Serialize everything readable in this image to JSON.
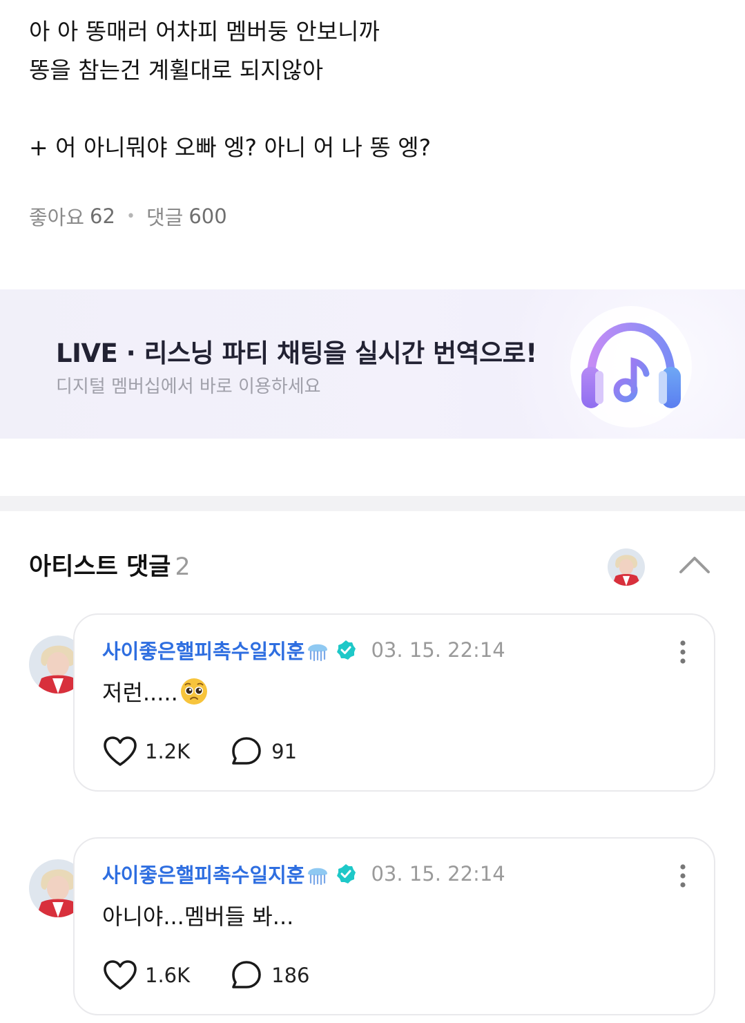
{
  "post": {
    "line1": "아 아 똥매러 어차피 멤버둥 안보니까",
    "line2": "똥을 참는건 계휠대로 되지않아",
    "line3": "+ 어 아니뭐야 오빠 엥? 아니 어 나 똥 엥?"
  },
  "stats": {
    "likes_label": "좋아요",
    "likes_count": "62",
    "comments_label": "댓글",
    "comments_count": "600"
  },
  "banner": {
    "title": "LIVE · 리스닝 파티 채팅을 실시간 번역으로!",
    "subtitle": "디지털 멤버십에서 바로 이용하세요",
    "icon": "headphones-music-icon",
    "accent": "#7b6cf0"
  },
  "artist_comments": {
    "title": "아티스트 댓글",
    "count": "2",
    "items": [
      {
        "author": "사이좋은핼피촉수일지훈",
        "timestamp": "03. 15. 22:14",
        "text": "저런.....",
        "emoji": "pleading-face-emoji",
        "likes": "1.2K",
        "replies": "91"
      },
      {
        "author": "사이좋은핼피촉수일지훈",
        "timestamp": "03. 15. 22:14",
        "text": "아니야...멤버들 봐...",
        "likes": "1.6K",
        "replies": "186"
      }
    ]
  },
  "colors": {
    "author": "#2e6ee0",
    "verified": "#1ec8c8",
    "muted": "#9a9a9a"
  }
}
